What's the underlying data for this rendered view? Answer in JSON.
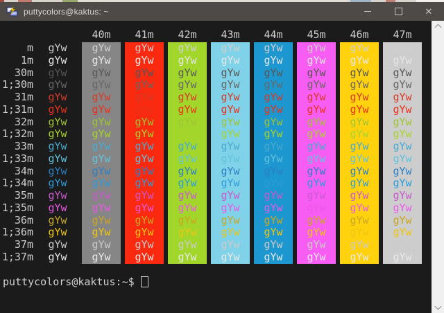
{
  "window": {
    "title": "puttycolors@kaktus: ~",
    "controls": {
      "minimize": "minimize",
      "maximize": "maximize",
      "close": "close",
      "close_glyph": "✕"
    }
  },
  "colors": {
    "titlebar_bg": "#4e4a47",
    "titlebar_text": "#d8d5d2",
    "terminal_bg": "#1b1b1b",
    "default_text": "#d0d0d0",
    "label_text": "#cfcfcf",
    "scrollbar_track": "#f0f0f0"
  },
  "terminal": {
    "cell_text": "gYw",
    "columns": [
      {
        "header": "40m",
        "bg": "#868686"
      },
      {
        "header": "41m",
        "bg": "#f92a10"
      },
      {
        "header": "42m",
        "bg": "#a2d62a"
      },
      {
        "header": "43m",
        "bg": "#7fd2e7"
      },
      {
        "header": "44m",
        "bg": "#1d97cf"
      },
      {
        "header": "45m",
        "bg": "#f75df2"
      },
      {
        "header": "46m",
        "bg": "#ffd20d"
      },
      {
        "header": "47m",
        "bg": "#cdcdcd"
      }
    ],
    "rows": [
      {
        "label": "m",
        "fg": "#d0d0d0"
      },
      {
        "label": "1m",
        "fg": "#e6e6e6"
      },
      {
        "label": "30m",
        "fg": "#555555"
      },
      {
        "label": "1;30m",
        "fg": "#666666"
      },
      {
        "label": "31m",
        "fg": "#d53a28"
      },
      {
        "label": "1;31m",
        "fg": "#e8321a"
      },
      {
        "label": "32m",
        "fg": "#9fc433"
      },
      {
        "label": "1;32m",
        "fg": "#a8d32e"
      },
      {
        "label": "33m",
        "fg": "#48aacf"
      },
      {
        "label": "1;33m",
        "fg": "#62c3dd"
      },
      {
        "label": "34m",
        "fg": "#2b7fc4"
      },
      {
        "label": "1;34m",
        "fg": "#2d9bd8"
      },
      {
        "label": "35m",
        "fg": "#ca59ce"
      },
      {
        "label": "1;35m",
        "fg": "#ea58e8"
      },
      {
        "label": "36m",
        "fg": "#c9a723"
      },
      {
        "label": "1;36m",
        "fg": "#eec613"
      },
      {
        "label": "37m",
        "fg": "#cbcbcb"
      },
      {
        "label": "1;37m",
        "fg": "#e9e9e9"
      }
    ],
    "prompt": "puttycolors@kaktus:~$"
  }
}
